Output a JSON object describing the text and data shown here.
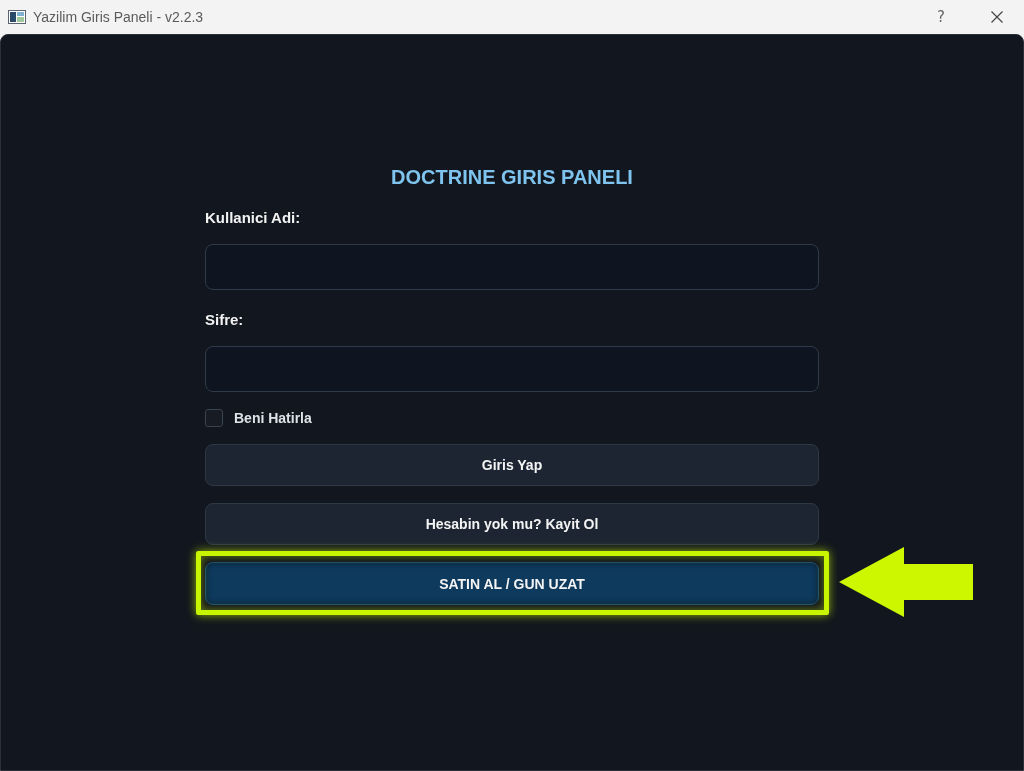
{
  "window": {
    "title": "Yazilim Giris Paneli - v2.2.3",
    "help_button": "?"
  },
  "heading": "DOCTRINE GIRIS PANELI",
  "fields": [
    {
      "label": "Kullanici Adi:"
    },
    {
      "label": "Sifre:"
    }
  ],
  "remember": {
    "label": "Beni Hatirla",
    "checked": false
  },
  "buttons": [
    {
      "label": "Giris Yap",
      "kind": "secondary",
      "highlighted": false
    },
    {
      "label": "Hesabin yok mu? Kayit Ol",
      "kind": "secondary",
      "highlighted": false
    },
    {
      "label": "SATIN AL / GUN UZAT",
      "kind": "primary",
      "highlighted": true
    }
  ]
}
